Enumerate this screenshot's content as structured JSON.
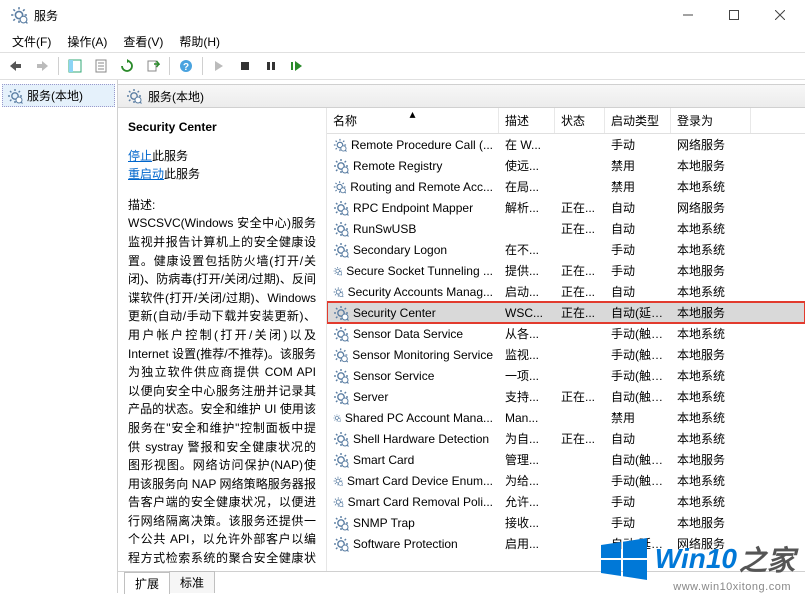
{
  "window": {
    "title": "服务"
  },
  "menu": {
    "file": "文件(F)",
    "action": "操作(A)",
    "view": "查看(V)",
    "help": "帮助(H)"
  },
  "tree": {
    "root": "服务(本地)"
  },
  "content_header": "服务(本地)",
  "detail": {
    "title": "Security Center",
    "stop_link": "停止",
    "stop_suffix": "此服务",
    "restart_link": "重启动",
    "restart_suffix": "此服务",
    "desc_label": "描述:",
    "desc_text": "WSCSVC(Windows 安全中心)服务监视并报告计算机上的安全健康设置。健康设置包括防火墙(打开/关闭)、防病毒(打开/关闭/过期)、反间谍软件(打开/关闭/过期)、Windows 更新(自动/手动下载并安装更新)、用户帐户控制(打开/关闭)以及 Internet 设置(推荐/不推荐)。该服务为独立软件供应商提供 COM API 以便向安全中心服务注册并记录其产品的状态。安全和维护 UI 使用该服务在\"安全和维护\"控制面板中提供 systray 警报和安全健康状况的图形视图。网络访问保护(NAP)使用该服务向 NAP 网络策略服务器报告客户端的安全健康状况，以便进行网络隔离决策。该服务还提供一个公共 API，以允许外部客户以编程方式检索系统的聚合安全健康状况。"
  },
  "columns": {
    "name": "名称",
    "desc": "描述",
    "status": "状态",
    "startup": "启动类型",
    "logon": "登录为"
  },
  "services": [
    {
      "name": "Remote Procedure Call (...",
      "desc": "在 W...",
      "status": "",
      "startup": "手动",
      "logon": "网络服务"
    },
    {
      "name": "Remote Registry",
      "desc": "使远...",
      "status": "",
      "startup": "禁用",
      "logon": "本地服务"
    },
    {
      "name": "Routing and Remote Acc...",
      "desc": "在局...",
      "status": "",
      "startup": "禁用",
      "logon": "本地系统"
    },
    {
      "name": "RPC Endpoint Mapper",
      "desc": "解析...",
      "status": "正在...",
      "startup": "自动",
      "logon": "网络服务"
    },
    {
      "name": "RunSwUSB",
      "desc": "",
      "status": "正在...",
      "startup": "自动",
      "logon": "本地系统"
    },
    {
      "name": "Secondary Logon",
      "desc": "在不...",
      "status": "",
      "startup": "手动",
      "logon": "本地系统"
    },
    {
      "name": "Secure Socket Tunneling ...",
      "desc": "提供...",
      "status": "正在...",
      "startup": "手动",
      "logon": "本地服务"
    },
    {
      "name": "Security Accounts Manag...",
      "desc": "启动...",
      "status": "正在...",
      "startup": "自动",
      "logon": "本地系统"
    },
    {
      "name": "Security Center",
      "desc": "WSC...",
      "status": "正在...",
      "startup": "自动(延迟...",
      "logon": "本地服务",
      "selected": true,
      "highlighted": true
    },
    {
      "name": "Sensor Data Service",
      "desc": "从各...",
      "status": "",
      "startup": "手动(触发...",
      "logon": "本地系统"
    },
    {
      "name": "Sensor Monitoring Service",
      "desc": "监视...",
      "status": "",
      "startup": "手动(触发...",
      "logon": "本地服务"
    },
    {
      "name": "Sensor Service",
      "desc": "一项...",
      "status": "",
      "startup": "手动(触发...",
      "logon": "本地系统"
    },
    {
      "name": "Server",
      "desc": "支持...",
      "status": "正在...",
      "startup": "自动(触发...",
      "logon": "本地系统"
    },
    {
      "name": "Shared PC Account Mana...",
      "desc": "Man...",
      "status": "",
      "startup": "禁用",
      "logon": "本地系统"
    },
    {
      "name": "Shell Hardware Detection",
      "desc": "为自...",
      "status": "正在...",
      "startup": "自动",
      "logon": "本地系统"
    },
    {
      "name": "Smart Card",
      "desc": "管理...",
      "status": "",
      "startup": "自动(触发...",
      "logon": "本地服务"
    },
    {
      "name": "Smart Card Device Enum...",
      "desc": "为给...",
      "status": "",
      "startup": "手动(触发...",
      "logon": "本地系统"
    },
    {
      "name": "Smart Card Removal Poli...",
      "desc": "允许...",
      "status": "",
      "startup": "手动",
      "logon": "本地系统"
    },
    {
      "name": "SNMP Trap",
      "desc": "接收...",
      "status": "",
      "startup": "手动",
      "logon": "本地服务"
    },
    {
      "name": "Software Protection",
      "desc": "启用...",
      "status": "",
      "startup": "自动(延迟...",
      "logon": "网络服务"
    }
  ],
  "tabs": {
    "extended": "扩展",
    "standard": "标准"
  },
  "watermark": {
    "brand1": "Win10",
    "brand2": "之家",
    "url": "www.win10xitong.com"
  }
}
